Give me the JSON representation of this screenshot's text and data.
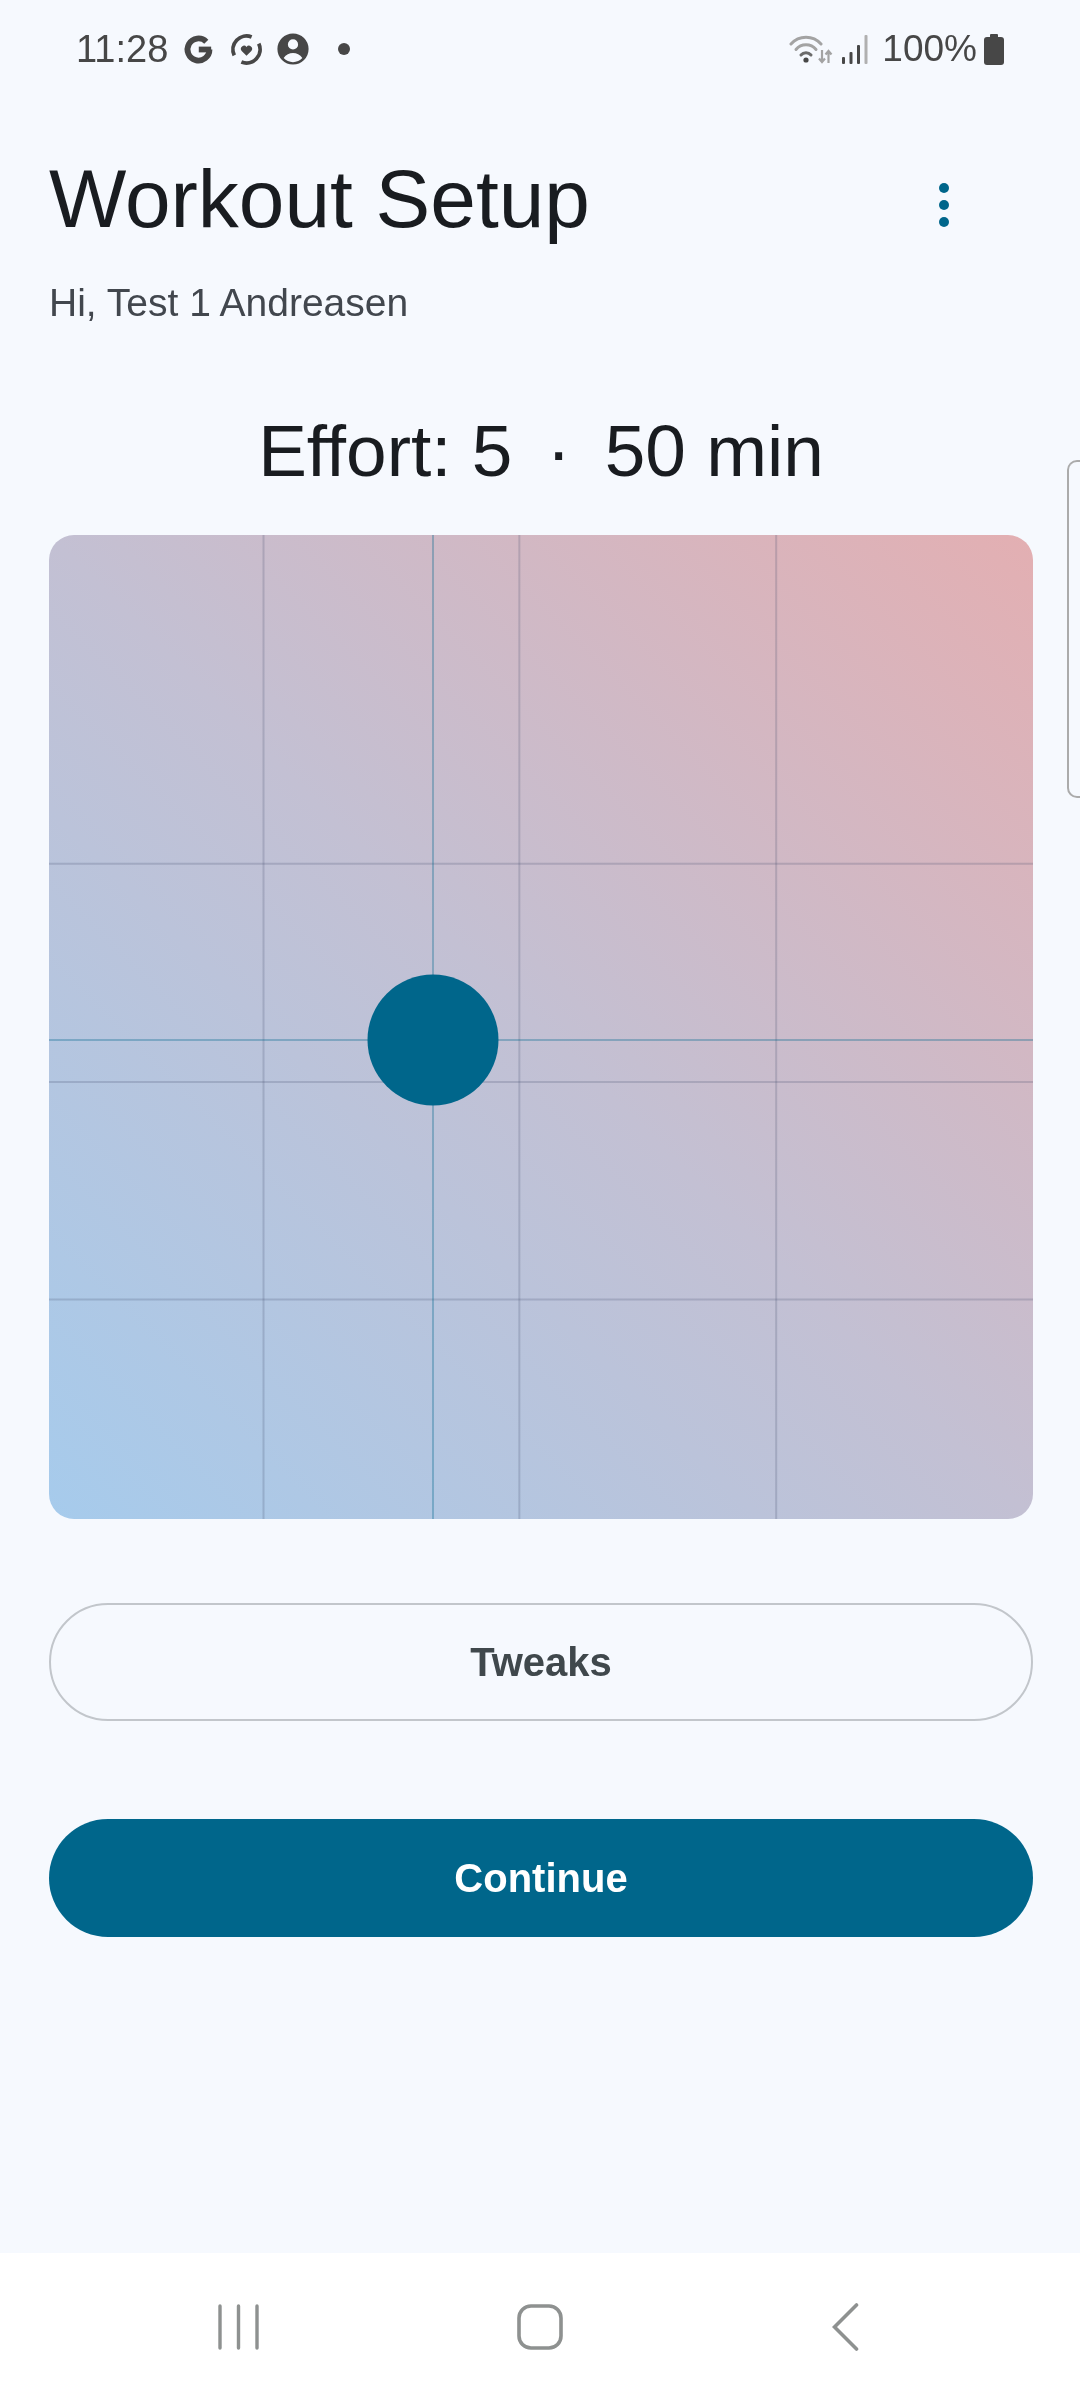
{
  "status_bar": {
    "time": "11:28",
    "battery": "100%"
  },
  "header": {
    "title": "Workout Setup",
    "greeting": "Hi, Test 1 Andreasen"
  },
  "summary": {
    "effort": "Effort: 5",
    "separator": "·",
    "duration": "50 min"
  },
  "pad": {
    "horizontal": {
      "level": 0.39
    },
    "vertical": {
      "level": 0.487
    }
  },
  "buttons": [
    {
      "label": "Tweaks",
      "kind": "outlined"
    },
    {
      "label": "Continue",
      "kind": "filled"
    }
  ]
}
